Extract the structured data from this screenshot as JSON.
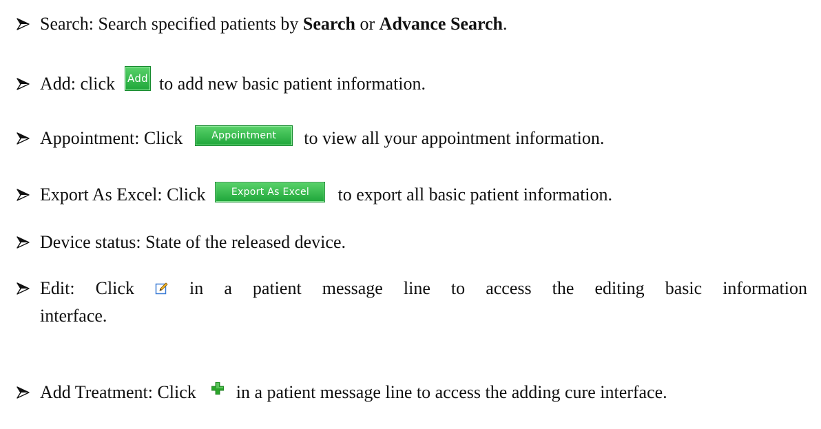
{
  "bullet_icon": "arrow-bullet-icon",
  "items": {
    "search": {
      "prefix": "Search: Search specified patients by ",
      "bold1": "Search",
      "mid": " or ",
      "bold2": "Advance Search",
      "suffix": "."
    },
    "add": {
      "before": "Add: click",
      "button": "Add",
      "after": "to add new basic patient information."
    },
    "appointment": {
      "before": "Appointment: Click",
      "button": "Appointment",
      "after": "to view all your appointment information."
    },
    "export": {
      "before": "Export As Excel: Click",
      "button": "Export As Excel",
      "after": "to export all basic patient information."
    },
    "device": {
      "text": "Device status: State of the released device."
    },
    "edit": {
      "words_line1": [
        "Edit:",
        "Click",
        "ICON",
        "in",
        "a",
        "patient",
        "message",
        "line",
        "to",
        "access",
        "the",
        "editing",
        "basic",
        "information"
      ],
      "line2": "interface.",
      "icon": "edit-pencil-icon"
    },
    "treatment": {
      "before": "Add Treatment: Click",
      "after": "in a patient message line to access the adding cure interface.",
      "icon": "green-plus-icon"
    }
  },
  "colors": {
    "button_green": "#1fa63a",
    "plus_green": "#2aa52a",
    "pencil_blue": "#3a7bd5"
  }
}
